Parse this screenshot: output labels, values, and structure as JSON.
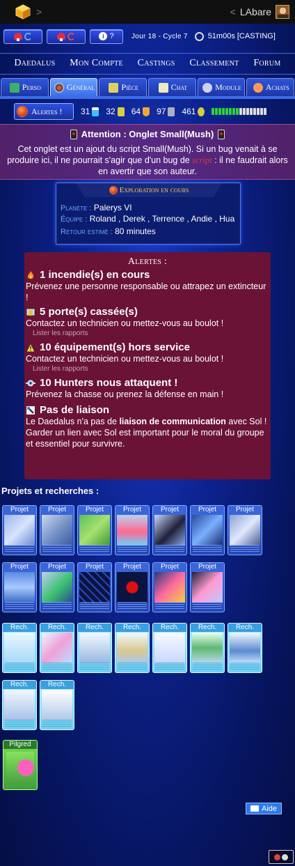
{
  "topbar": {
    "username": "LAbare",
    "back_chevron": "<",
    "forward_chevron": ">"
  },
  "status": {
    "day_cycle": "Jour 18 - Cycle 7",
    "pa": "51m00s [CASTING]",
    "help_label": "?"
  },
  "nav": [
    "Daedalus",
    "Mon Compte",
    "Castings",
    "Classement",
    "Forum"
  ],
  "tabs": [
    {
      "label": "Perso",
      "icon": "character-icon",
      "color": "#3fae6a"
    },
    {
      "label": "Général",
      "icon": "target-icon",
      "color": "#e05030",
      "active": true
    },
    {
      "label": "Pièce",
      "icon": "room-icon",
      "color": "#e0d060"
    },
    {
      "label": "Chat",
      "icon": "book-icon",
      "color": "#f0e8c0"
    },
    {
      "label": "Module",
      "icon": "module-icon",
      "color": "#d0d0f0"
    },
    {
      "label": "Achats",
      "icon": "shop-icon",
      "color": "#ff9a55"
    }
  ],
  "alertbar": {
    "label": "Alertes !",
    "oxygen": "31",
    "fuel": "32",
    "armor": "64",
    "shield": "97",
    "energy": "461"
  },
  "warning": {
    "title": "Attention : Onglet Small(Mush)",
    "text_before": "Cet onglet est un ajout du script Small(Mush). Si un bug venait à se produire ici, il ne pourrait s'agir que d'un bug de ",
    "script_word": "script",
    "text_after": " : il ne faudrait alors en avertir que son auteur."
  },
  "expedition": {
    "title": "Exploration en cours",
    "planet_label": "Planète :",
    "planet": "Palerys VI",
    "team_label": "Équipe :",
    "team": "Roland , Derek , Terrence , Andie , Hua",
    "return_label": "Retour estimé :",
    "return_value": "80 minutes"
  },
  "alerts": {
    "title": "Alertes :",
    "items": [
      {
        "icon": "fire-icon",
        "title": "1 incendie(s) en cours",
        "text": "Prévenez une personne responsable ou attrapez un extincteur !",
        "link": ""
      },
      {
        "icon": "door-icon",
        "title": "5 porte(s) cassée(s)",
        "text": "Contactez un technicien ou mettez-vous au boulot !",
        "link": "Lister les rapports"
      },
      {
        "icon": "warning-icon",
        "title": "10 équipement(s) hors service",
        "text": "Contactez un technicien ou mettez-vous au boulot !",
        "link": "Lister les rapports"
      },
      {
        "icon": "hunter-icon",
        "title": "10 Hunters nous attaquent !",
        "text": "Prévenez la chasse ou prenez la défense en main !",
        "link": ""
      },
      {
        "icon": "antenna-icon",
        "title": "Pas de liaison",
        "text_before": "Le Daedalus n'a pas de ",
        "text_bold": "liaison de communication",
        "text_after": " avec Sol !",
        "text2": "Garder un lien avec Sol est important pour le moral du groupe et essentiel pour survivre.",
        "link": ""
      }
    ]
  },
  "projects": {
    "title": "Projets et recherches :",
    "project_label": "Projet",
    "research_label": "Rech.",
    "pilgred_label": "Pilgred"
  },
  "help": {
    "label": "Aide"
  }
}
